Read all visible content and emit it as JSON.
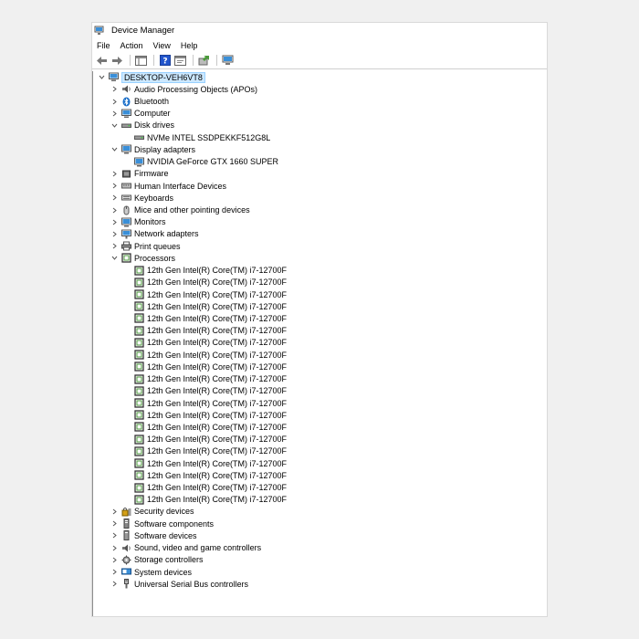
{
  "window": {
    "title": "Device Manager"
  },
  "menu": [
    "File",
    "Action",
    "View",
    "Help"
  ],
  "toolbar": [
    "back-icon",
    "forward-icon",
    "show-hide-console-tree-icon",
    "help-icon",
    "properties-icon",
    "update-driver-icon",
    "scan-hardware-icon"
  ],
  "tree": {
    "root": "DESKTOP-VEH6VT8",
    "categories": [
      {
        "label": "Audio Processing Objects (APOs)",
        "icon": "audio-icon",
        "expanded": false
      },
      {
        "label": "Bluetooth",
        "icon": "bluetooth-icon",
        "expanded": false
      },
      {
        "label": "Computer",
        "icon": "computer-icon",
        "expanded": false
      },
      {
        "label": "Disk drives",
        "icon": "disk-drive-icon",
        "expanded": true,
        "children": [
          "NVMe INTEL SSDPEKKF512G8L"
        ]
      },
      {
        "label": "Display adapters",
        "icon": "display-adapter-icon",
        "expanded": true,
        "children": [
          "NVIDIA GeForce GTX 1660 SUPER"
        ]
      },
      {
        "label": "Firmware",
        "icon": "firmware-icon",
        "expanded": false
      },
      {
        "label": "Human Interface Devices",
        "icon": "hid-icon",
        "expanded": false
      },
      {
        "label": "Keyboards",
        "icon": "keyboard-icon",
        "expanded": false
      },
      {
        "label": "Mice and other pointing devices",
        "icon": "mouse-icon",
        "expanded": false
      },
      {
        "label": "Monitors",
        "icon": "monitor-icon",
        "expanded": false
      },
      {
        "label": "Network adapters",
        "icon": "network-adapter-icon",
        "expanded": false
      },
      {
        "label": "Print queues",
        "icon": "printer-icon",
        "expanded": false
      },
      {
        "label": "Processors",
        "icon": "processor-icon",
        "expanded": true,
        "children": [
          "12th Gen Intel(R) Core(TM) i7-12700F",
          "12th Gen Intel(R) Core(TM) i7-12700F",
          "12th Gen Intel(R) Core(TM) i7-12700F",
          "12th Gen Intel(R) Core(TM) i7-12700F",
          "12th Gen Intel(R) Core(TM) i7-12700F",
          "12th Gen Intel(R) Core(TM) i7-12700F",
          "12th Gen Intel(R) Core(TM) i7-12700F",
          "12th Gen Intel(R) Core(TM) i7-12700F",
          "12th Gen Intel(R) Core(TM) i7-12700F",
          "12th Gen Intel(R) Core(TM) i7-12700F",
          "12th Gen Intel(R) Core(TM) i7-12700F",
          "12th Gen Intel(R) Core(TM) i7-12700F",
          "12th Gen Intel(R) Core(TM) i7-12700F",
          "12th Gen Intel(R) Core(TM) i7-12700F",
          "12th Gen Intel(R) Core(TM) i7-12700F",
          "12th Gen Intel(R) Core(TM) i7-12700F",
          "12th Gen Intel(R) Core(TM) i7-12700F",
          "12th Gen Intel(R) Core(TM) i7-12700F",
          "12th Gen Intel(R) Core(TM) i7-12700F",
          "12th Gen Intel(R) Core(TM) i7-12700F"
        ]
      },
      {
        "label": "Security devices",
        "icon": "security-device-icon",
        "expanded": false
      },
      {
        "label": "Software components",
        "icon": "software-component-icon",
        "expanded": false
      },
      {
        "label": "Software devices",
        "icon": "software-device-icon",
        "expanded": false
      },
      {
        "label": "Sound, video and game controllers",
        "icon": "sound-icon",
        "expanded": false
      },
      {
        "label": "Storage controllers",
        "icon": "storage-controller-icon",
        "expanded": false
      },
      {
        "label": "System devices",
        "icon": "system-device-icon",
        "expanded": false
      },
      {
        "label": "Universal Serial Bus controllers",
        "icon": "usb-icon",
        "expanded": false
      }
    ]
  },
  "colors": {
    "selection": "#cce8ff",
    "selection_border": "#99d1ff",
    "monitor_blue": "#3a8fd8",
    "help_blue": "#2255cc",
    "green": "#4c9a3c"
  }
}
